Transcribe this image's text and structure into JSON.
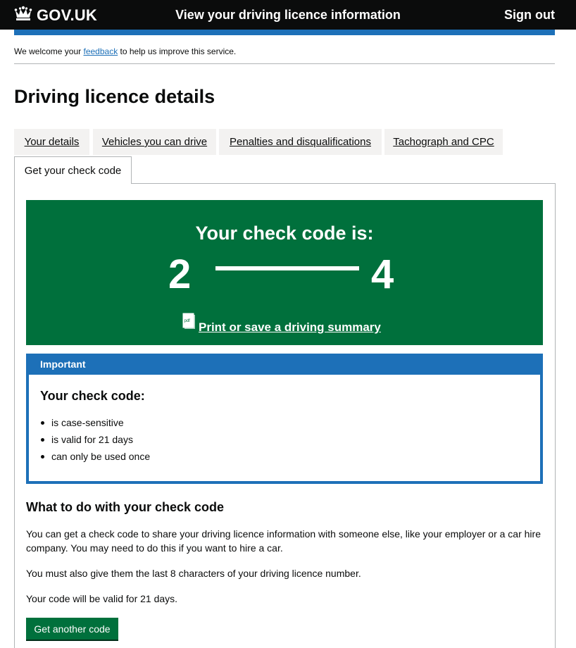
{
  "header": {
    "logo_text": "GOV.UK",
    "service_name": "View your driving licence information",
    "sign_out": "Sign out"
  },
  "feedback": {
    "prefix": "We welcome your ",
    "link": "feedback",
    "suffix": " to help us improve this service."
  },
  "page_title": "Driving licence details",
  "tabs": [
    {
      "label": "Your details"
    },
    {
      "label": "Vehicles you can drive"
    },
    {
      "label": "Penalties and disqualifications"
    },
    {
      "label": "Tachograph and CPC"
    },
    {
      "label": "Get your check code",
      "selected": true
    }
  ],
  "check_code": {
    "title": "Your check code is:",
    "first_char": "2",
    "last_char": "4",
    "pdf_icon_label": "pdf",
    "print_link": "Print or save a driving summary"
  },
  "important": {
    "header": "Important",
    "heading": "Your check code:",
    "items": [
      "is case-sensitive",
      "is valid for 21 days",
      "can only be used once"
    ]
  },
  "what_to_do": {
    "heading": "What to do with your check code",
    "paragraphs": [
      "You can get a check code to share your driving licence information with someone else, like your employer or a car hire company. You may need to do this if you want to hire a car.",
      "You must also give them the last 8 characters of your driving licence number.",
      "Your code will be valid for 21 days."
    ]
  },
  "button": {
    "label": "Get another code"
  },
  "colors": {
    "header_bg": "#0b0c0c",
    "brand_blue": "#1d70b8",
    "green": "#00703c"
  },
  "icons": {
    "logo": "crown-icon",
    "print": "pdf-icon"
  }
}
